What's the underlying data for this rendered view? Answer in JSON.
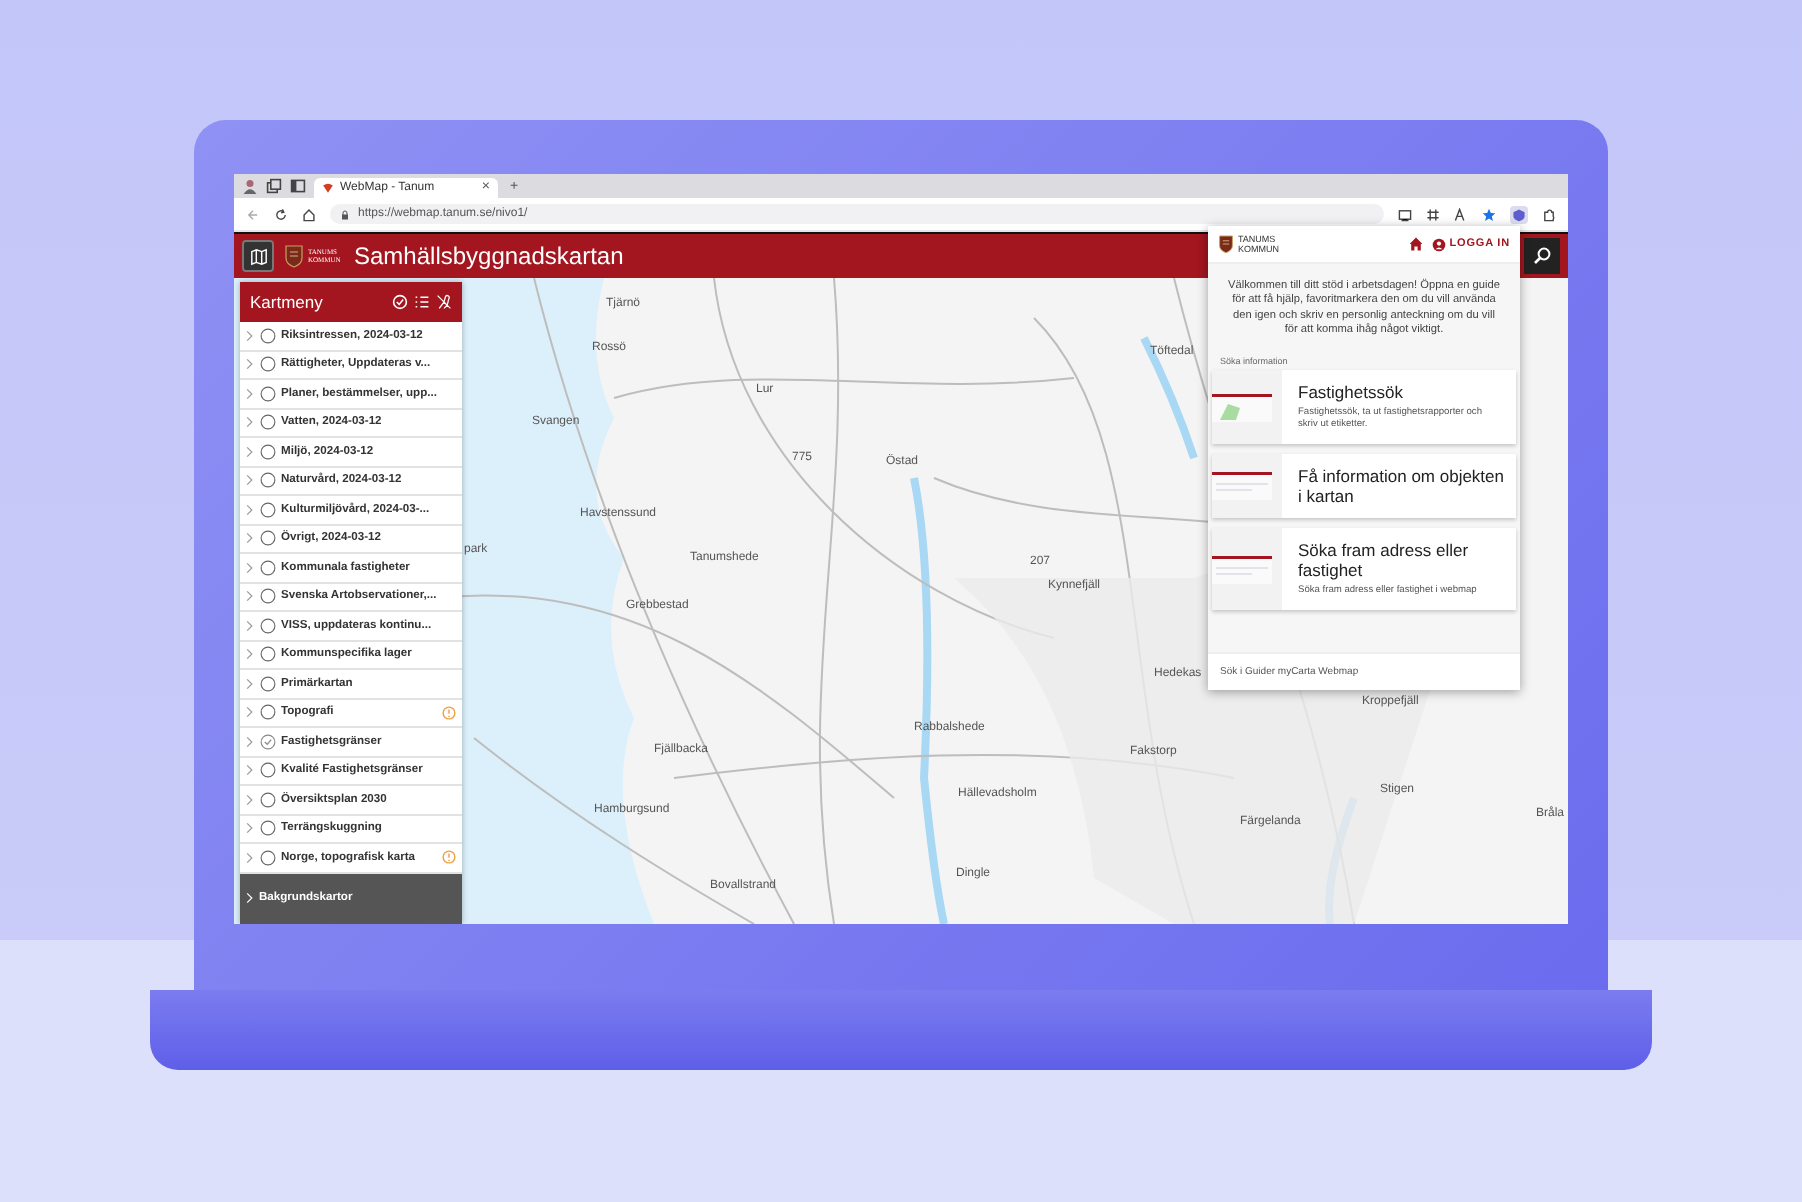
{
  "browser": {
    "tab_title": "WebMap - Tanum",
    "new_tab": "+",
    "tab_close": "×",
    "url": "https://webmap.tanum.se/nivo1/"
  },
  "app": {
    "logo_text": "TANUMS KOMMUN",
    "title": "Samhällsbyggnadskartan"
  },
  "sidebar": {
    "title": "Kartmeny",
    "items": [
      {
        "label": "Riksintressen, 2024-03-12",
        "checked": false,
        "info": false
      },
      {
        "label": "Rättigheter, Uppdateras v...",
        "checked": false,
        "info": false
      },
      {
        "label": "Planer, bestämmelser, upp...",
        "checked": false,
        "info": false
      },
      {
        "label": "Vatten, 2024-03-12",
        "checked": false,
        "info": false
      },
      {
        "label": "Miljö, 2024-03-12",
        "checked": false,
        "info": false
      },
      {
        "label": "Naturvård, 2024-03-12",
        "checked": false,
        "info": false
      },
      {
        "label": "Kulturmiljövård, 2024-03-...",
        "checked": false,
        "info": false
      },
      {
        "label": "Övrigt, 2024-03-12",
        "checked": false,
        "info": false
      },
      {
        "label": "Kommunala fastigheter",
        "checked": false,
        "info": false
      },
      {
        "label": "Svenska Artobservationer,...",
        "checked": false,
        "info": false
      },
      {
        "label": "VISS, uppdateras kontinu...",
        "checked": false,
        "info": false
      },
      {
        "label": "Kommunspecifika lager",
        "checked": false,
        "info": false
      },
      {
        "label": "Primärkartan",
        "checked": false,
        "info": false
      },
      {
        "label": "Topografi",
        "checked": false,
        "info": true
      },
      {
        "label": "Fastighetsgränser",
        "checked": true,
        "info": false
      },
      {
        "label": "Kvalité Fastighetsgränser",
        "checked": false,
        "info": false
      },
      {
        "label": "Översiktsplan 2030",
        "checked": false,
        "info": false
      },
      {
        "label": "Terrängskuggning",
        "checked": false,
        "info": false
      },
      {
        "label": "Norge, topografisk karta",
        "checked": false,
        "info": true
      }
    ],
    "footer": "Bakgrundskartor"
  },
  "map": {
    "places": [
      "Tjärnö",
      "Rossö",
      "Svangen",
      "Lur",
      "775",
      "Östad",
      "Töftedal",
      "Havstenssund",
      "park",
      "Tanumshede",
      "Grebbestad",
      "207",
      "Kynnefjäll",
      "Hedekas",
      "Rabbalshede",
      "Fakstorp",
      "Fjällbacka",
      "Hällevadsholm",
      "Hamburgsund",
      "Dingle",
      "Bovallstrand",
      "Kroppefjäll",
      "Stigen",
      "Färgelanda",
      "Bråla"
    ]
  },
  "panel": {
    "logo_text": "TANUMS KOMMUN",
    "login": "LOGGA IN",
    "intro": "Välkommen till ditt stöd i arbetsdagen! Öppna en guide för att få hjälp, favoritmarkera den om du vill använda den igen och skriv en personlig anteckning om du vill för att komma ihåg något viktigt.",
    "section": "Söka information",
    "cards": [
      {
        "title": "Fastighetssök",
        "description": "Fastighetssök, ta ut fastighetsrapporter och skriv ut etiketter."
      },
      {
        "title": "Få information om objekten i kartan"
      },
      {
        "title": "Söka fram adress eller fastighet",
        "description": "Söka fram adress eller fastighet i webmap"
      }
    ],
    "footer": "Sök i Guider myCarta Webmap"
  }
}
